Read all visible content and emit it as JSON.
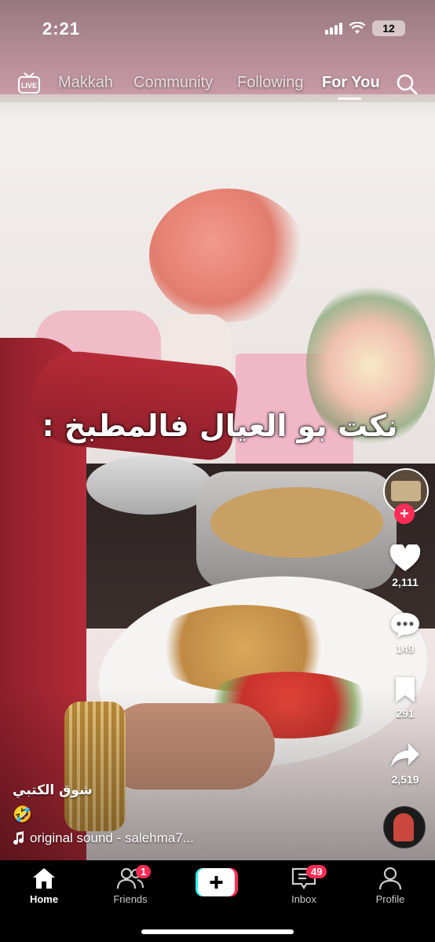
{
  "status_bar": {
    "time": "2:21",
    "battery": "12"
  },
  "top_nav": {
    "live_label": "LIVE",
    "tabs": [
      "Makkah",
      "Community",
      "Following",
      "For You"
    ],
    "active_tab": "For You"
  },
  "video": {
    "overlay_caption": "نكت بو العيال فالمطبخ :"
  },
  "actions": {
    "likes": "2,111",
    "comments": "149",
    "saves": "291",
    "shares": "2,519"
  },
  "description": {
    "username": "شوق الكتبي",
    "caption_emoji": "🤣",
    "sound": "original sound - salehma7..."
  },
  "bottom_nav": {
    "home": "Home",
    "friends": "Friends",
    "friends_badge": "1",
    "inbox": "Inbox",
    "inbox_badge": "49",
    "profile": "Profile"
  },
  "colors": {
    "accent": "#fe2c55",
    "create_cyan": "#25f4ee"
  },
  "icons": [
    "live-icon",
    "search-icon",
    "heart-icon",
    "comment-icon",
    "bookmark-icon",
    "share-icon",
    "home-icon",
    "friends-icon",
    "create-icon",
    "inbox-icon",
    "profile-icon",
    "music-note-icon"
  ]
}
